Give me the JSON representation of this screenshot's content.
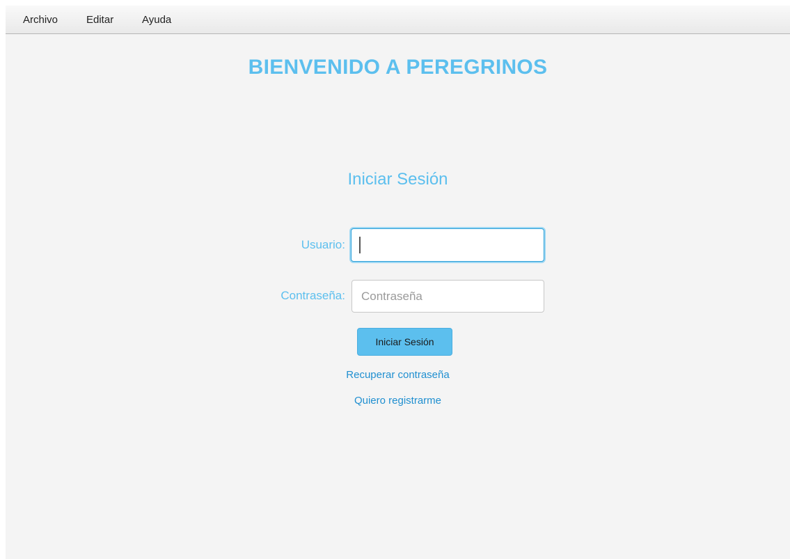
{
  "menubar": {
    "items": [
      "Archivo",
      "Editar",
      "Ayuda"
    ]
  },
  "welcome": {
    "title": "BIENVENIDO A PEREGRINOS"
  },
  "login": {
    "title": "Iniciar Sesión",
    "username_label": "Usuario:",
    "username_value": "",
    "password_label": "Contraseña:",
    "password_placeholder": "Contraseña",
    "submit_label": "Iniciar Sesión",
    "recover_link": "Recuperar contraseña",
    "register_link": "Quiero registrarme"
  },
  "colors": {
    "accent": "#5cbfee",
    "link": "#1f8fd0",
    "background": "#f4f4f4"
  }
}
